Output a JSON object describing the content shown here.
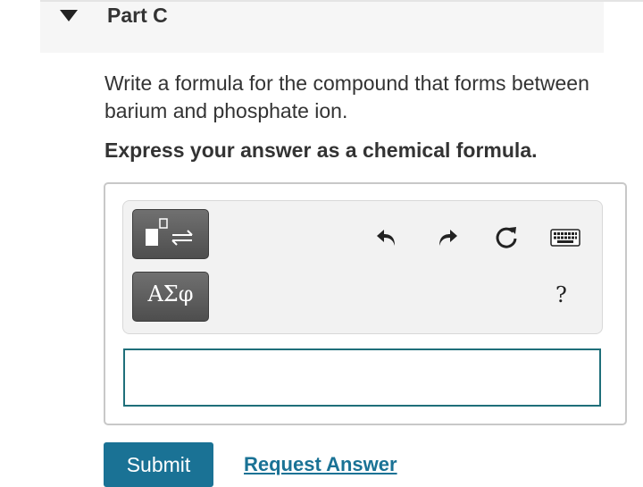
{
  "part": {
    "title": "Part C",
    "collapse_icon": "caret-down-icon"
  },
  "question": {
    "text": "Write a formula for the compound that forms between barium and phosphate ion.",
    "instruction": "Express your answer as a chemical formula."
  },
  "toolbar": {
    "template_icon": "template-arrows-icon",
    "symbols_label": "ΑΣφ",
    "undo_icon": "undo-icon",
    "redo_icon": "redo-icon",
    "reset_icon": "reset-icon",
    "keyboard_icon": "keyboard-icon",
    "help_label": "?"
  },
  "answer": {
    "value": "",
    "placeholder": ""
  },
  "actions": {
    "submit_label": "Submit",
    "request_label": "Request Answer"
  },
  "colors": {
    "accent": "#1a7295",
    "input_border": "#1f6f7a"
  }
}
